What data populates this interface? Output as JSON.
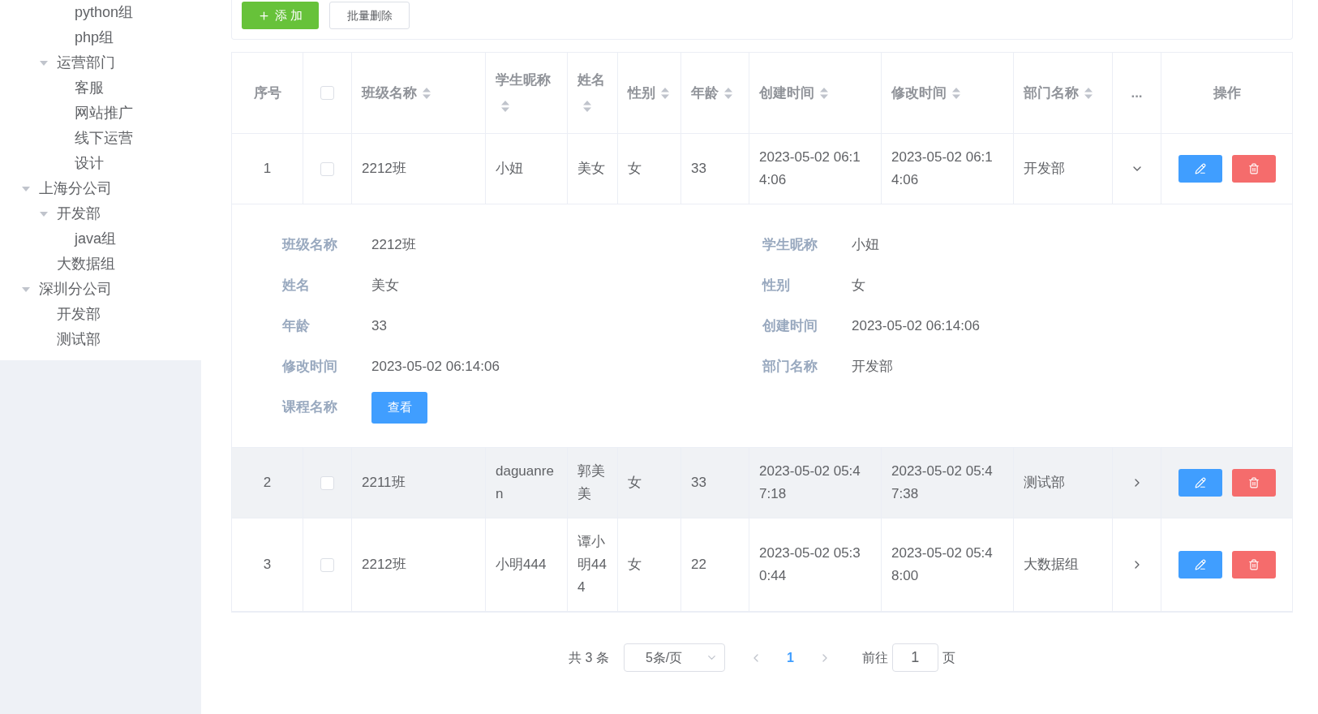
{
  "tree": [
    {
      "children": [
        {
          "children": [
            {
              "label": "python组"
            },
            {
              "label": "php组"
            }
          ]
        },
        {
          "label": "运营部门",
          "expanded": true,
          "children": [
            {
              "label": "客服"
            },
            {
              "label": "网站推广"
            },
            {
              "label": "线下运营"
            },
            {
              "label": "设计"
            }
          ]
        }
      ]
    },
    {
      "label": "上海分公司",
      "expanded": true,
      "children": [
        {
          "label": "开发部",
          "expanded": true,
          "children": [
            {
              "label": "java组"
            }
          ]
        },
        {
          "label": "大数据组"
        }
      ]
    },
    {
      "label": "深圳分公司",
      "expanded": true,
      "children": [
        {
          "label": "开发部"
        },
        {
          "label": "测试部"
        }
      ]
    }
  ],
  "toolbar": {
    "add_button": "添 加",
    "batch_delete_button": "批量删除"
  },
  "table": {
    "index_heading": "序号",
    "select_all_checked": false,
    "columns": [
      {
        "label": "班级名称",
        "sortable": true
      },
      {
        "label": "学生昵称",
        "sortable": true
      },
      {
        "label": "姓名",
        "sortable": true
      },
      {
        "label": "性别",
        "sortable": true
      },
      {
        "label": "年龄",
        "sortable": true
      },
      {
        "label": "创建时间",
        "sortable": true
      },
      {
        "label": "修改时间",
        "sortable": true
      },
      {
        "label": "部门名称",
        "sortable": true
      }
    ],
    "expand_heading": "...",
    "actions_heading": "操作",
    "rows": [
      {
        "index": "1",
        "checked": false,
        "expanded": true,
        "highlighted": false,
        "cells": [
          "2212班",
          "小妞",
          "美女",
          "女",
          "33",
          "2023-05-02 06:14:06",
          "2023-05-02 06:14:06",
          "开发部"
        ],
        "detail": {
          "fields": [
            {
              "label": "班级名称",
              "value": "2212班"
            },
            {
              "label": "学生昵称",
              "value": "小妞"
            },
            {
              "label": "姓名",
              "value": "美女"
            },
            {
              "label": "性别",
              "value": "女"
            },
            {
              "label": "年龄",
              "value": "33"
            },
            {
              "label": "创建时间",
              "value": "2023-05-02 06:14:06"
            },
            {
              "label": "修改时间",
              "value": "2023-05-02 06:14:06"
            },
            {
              "label": "部门名称",
              "value": "开发部"
            }
          ],
          "course": {
            "label": "课程名称",
            "button": "查看"
          }
        }
      },
      {
        "index": "2",
        "checked": false,
        "expanded": false,
        "highlighted": true,
        "cells": [
          "2211班",
          "daguanren",
          "郭美美",
          "女",
          "33",
          "2023-05-02 05:47:18",
          "2023-05-02 05:47:38",
          "测试部"
        ]
      },
      {
        "index": "3",
        "checked": false,
        "expanded": false,
        "highlighted": false,
        "cells": [
          "2212班",
          "小明444",
          "谭小明444",
          "女",
          "22",
          "2023-05-02 05:30:44",
          "2023-05-02 05:48:00",
          "大数据组"
        ]
      }
    ]
  },
  "pagination": {
    "total": "共 3 条",
    "page_size": "5条/页",
    "pages": [
      {
        "label": "1",
        "selected": true
      }
    ],
    "goto_label": "前往",
    "goto_value": "1",
    "page_suffix": "页"
  }
}
